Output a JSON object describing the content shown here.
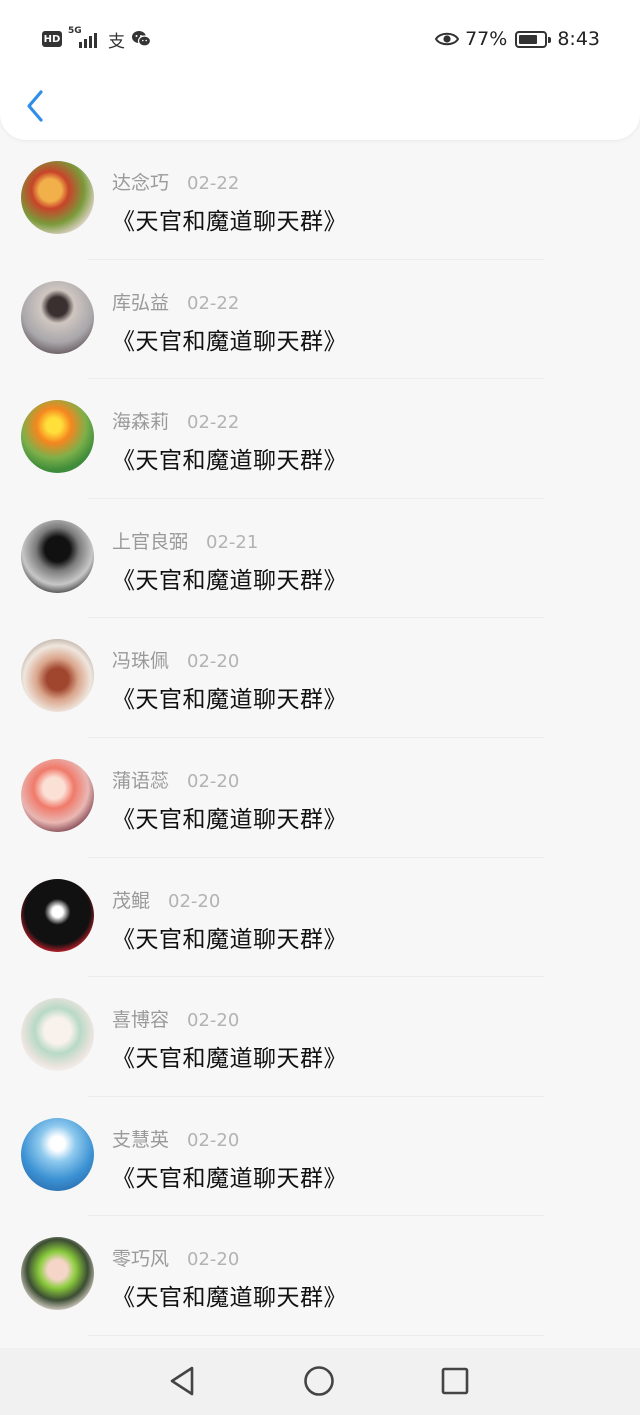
{
  "status_bar": {
    "hd": "HD",
    "network": "5G",
    "alipay_glyph": "支",
    "battery_percent": "77%",
    "battery_level": 0.77,
    "time": "8:43",
    "icons": [
      "hd-icon",
      "signal-icon",
      "alipay-icon",
      "wechat-icon",
      "eye-icon",
      "battery-icon"
    ]
  },
  "header": {
    "back_icon": "back-chevron-icon",
    "accent_color": "#2f8ee8"
  },
  "messages": [
    {
      "name": "达念巧",
      "date": "02-22",
      "text": "《天官和魔道聊天群》"
    },
    {
      "name": "库弘益",
      "date": "02-22",
      "text": "《天官和魔道聊天群》"
    },
    {
      "name": "海森莉",
      "date": "02-22",
      "text": "《天官和魔道聊天群》"
    },
    {
      "name": "上官良弼",
      "date": "02-21",
      "text": "《天官和魔道聊天群》"
    },
    {
      "name": "冯珠佩",
      "date": "02-20",
      "text": "《天官和魔道聊天群》"
    },
    {
      "name": "蒲语蕊",
      "date": "02-20",
      "text": "《天官和魔道聊天群》"
    },
    {
      "name": "茂鲲",
      "date": "02-20",
      "text": "《天官和魔道聊天群》"
    },
    {
      "name": "喜博容",
      "date": "02-20",
      "text": "《天官和魔道聊天群》"
    },
    {
      "name": "支慧英",
      "date": "02-20",
      "text": "《天官和魔道聊天群》"
    },
    {
      "name": "零巧风",
      "date": "02-20",
      "text": "《天官和魔道聊天群》"
    }
  ],
  "nav_bar": {
    "icons": [
      "back-triangle-icon",
      "home-circle-icon",
      "recents-square-icon"
    ]
  }
}
